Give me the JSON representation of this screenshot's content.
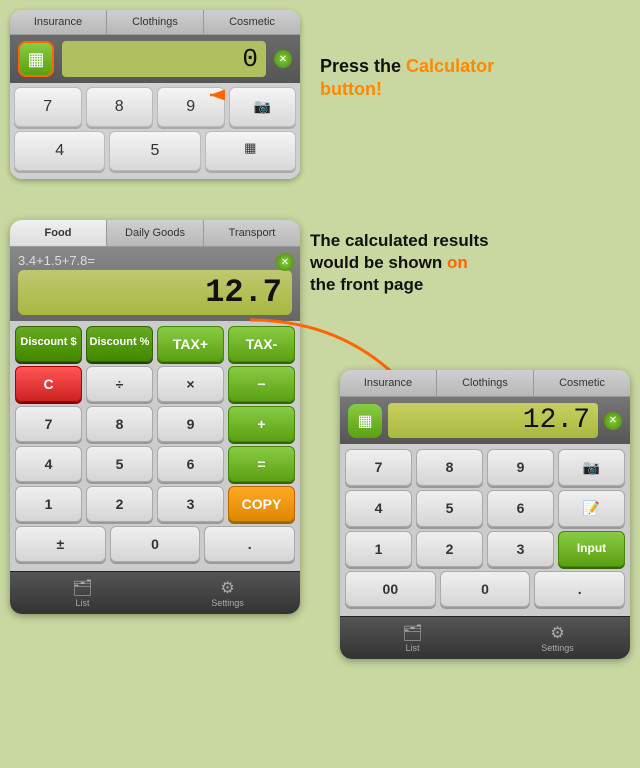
{
  "top_phone": {
    "tabs": [
      "Insurance",
      "Clothings",
      "Cosmetic"
    ],
    "display": {
      "number": "0",
      "close": "✕"
    },
    "keys": [
      [
        "7",
        "8",
        "9",
        "📷"
      ],
      [
        "4",
        "5",
        "▦"
      ]
    ],
    "calc_icon": "▦"
  },
  "annotation_top": {
    "prefix": "Press the ",
    "highlight": "Calculator",
    "suffix": " button!",
    "highlight2": "button!"
  },
  "main_calc": {
    "tabs": [
      "Food",
      "Daily Goods",
      "Transport"
    ],
    "expression": "3.4+1.5+7.8=",
    "result": "12.7",
    "close": "✕",
    "special_keys": [
      "Discount $",
      "Discount %",
      "TAX+",
      "TAX-"
    ],
    "rows": [
      [
        "C",
        "÷",
        "×",
        "−"
      ],
      [
        "7",
        "8",
        "9",
        "+"
      ],
      [
        "4",
        "5",
        "6",
        "="
      ],
      [
        "1",
        "2",
        "3",
        "COPY"
      ],
      [
        "±",
        "0",
        "."
      ]
    ],
    "nav": [
      {
        "icon": "🗂",
        "label": "List"
      },
      {
        "icon": "⚙",
        "label": "Settings"
      }
    ]
  },
  "annotation_bottom": {
    "text1": "The calculated results",
    "text2": "would be shown ",
    "highlight": "on",
    "text3": "the front page"
  },
  "right_calc": {
    "tabs": [
      "Insurance",
      "Clothings",
      "Cosmetic"
    ],
    "result": "12.7",
    "close": "✕",
    "rows": [
      [
        "7",
        "8",
        "9",
        "📷"
      ],
      [
        "4",
        "5",
        "6",
        "📝"
      ],
      [
        "1",
        "2",
        "3",
        "Input"
      ],
      [
        "00",
        "0",
        "."
      ]
    ],
    "nav": [
      {
        "icon": "🗂",
        "label": "List"
      },
      {
        "icon": "⚙",
        "label": "Settings"
      }
    ]
  }
}
